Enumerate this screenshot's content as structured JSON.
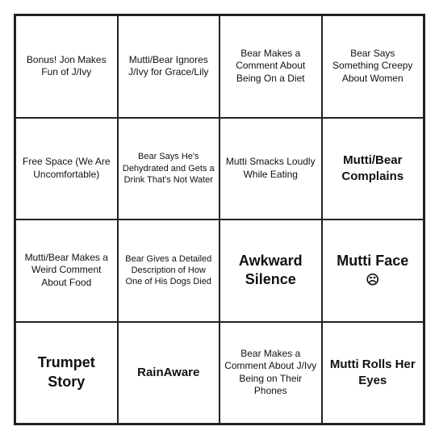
{
  "cells": [
    {
      "id": "r0c0",
      "text": "Bonus! Jon Makes Fun of J/Ivy",
      "size": "normal"
    },
    {
      "id": "r0c1",
      "text": "Mutti/Bear Ignores J/Ivy for Grace/Lily",
      "size": "normal"
    },
    {
      "id": "r0c2",
      "text": "Bear Makes a Comment About Being On a Diet",
      "size": "normal"
    },
    {
      "id": "r0c3",
      "text": "Bear Says Something Creepy About Women",
      "size": "normal"
    },
    {
      "id": "r1c0",
      "text": "Free Space (We Are Uncomfortable)",
      "size": "normal"
    },
    {
      "id": "r1c1",
      "text": "Bear Says He's Dehydrated and Gets a Drink That's Not Water",
      "size": "small"
    },
    {
      "id": "r1c2",
      "text": "Mutti Smacks Loudly While Eating",
      "size": "normal"
    },
    {
      "id": "r1c3",
      "text": "Mutti/Bear Complains",
      "size": "medium"
    },
    {
      "id": "r2c0",
      "text": "Mutti/Bear Makes a Weird Comment About Food",
      "size": "normal"
    },
    {
      "id": "r2c1",
      "text": "Bear Gives a Detailed Description of How One of His Dogs Died",
      "size": "small"
    },
    {
      "id": "r2c2",
      "text": "Awkward Silence",
      "size": "large"
    },
    {
      "id": "r2c3",
      "text": "Mutti Face",
      "size": "large",
      "hasIcon": true
    },
    {
      "id": "r3c0",
      "text": "Trumpet Story",
      "size": "large"
    },
    {
      "id": "r3c1",
      "text": "RainAware",
      "size": "medium"
    },
    {
      "id": "r3c2",
      "text": "Bear Makes a Comment About J/Ivy Being on Their Phones",
      "size": "normal"
    },
    {
      "id": "r3c3",
      "text": "Mutti Rolls Her Eyes",
      "size": "medium"
    }
  ]
}
